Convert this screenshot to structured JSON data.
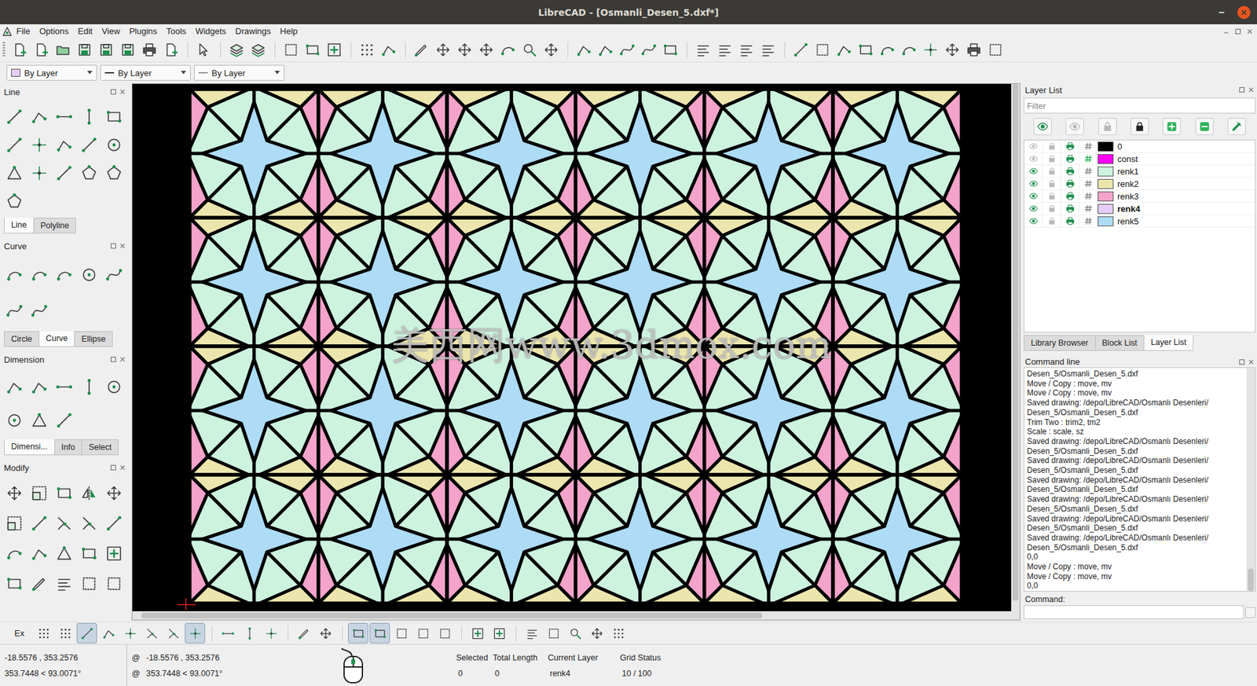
{
  "window": {
    "title": "LibreCAD - [Osmanli_Desen_5.dxf*]",
    "buttons": [
      {
        "label": "–",
        "kind": "minimize"
      },
      {
        "label": "×",
        "kind": "close"
      }
    ]
  },
  "menu": [
    "File",
    "Options",
    "Edit",
    "View",
    "Plugins",
    "Tools",
    "Widgets",
    "Drawings",
    "Help"
  ],
  "pen_toolbar": [
    {
      "label": "By Layer",
      "kind": "color"
    },
    {
      "label": "By Layer",
      "kind": "width"
    },
    {
      "label": "By Layer",
      "kind": "type"
    }
  ],
  "tool_docks": [
    {
      "title": "Line",
      "tabs": [
        {
          "label": "Line",
          "selected": true
        },
        {
          "label": "Polyline",
          "selected": false
        }
      ]
    },
    {
      "title": "Curve",
      "tabs": [
        {
          "label": "Circle",
          "selected": false
        },
        {
          "label": "Curve",
          "selected": true
        },
        {
          "label": "Ellipse",
          "selected": false
        }
      ]
    },
    {
      "title": "Dimension",
      "tabs": [
        {
          "label": "Dimensi...",
          "selected": true
        },
        {
          "label": "Info",
          "selected": false
        },
        {
          "label": "Select",
          "selected": false
        }
      ]
    },
    {
      "title": "Modify",
      "tabs": []
    }
  ],
  "canvas": {
    "watermark": "美西网www.3dmox.com",
    "h_scroll": {
      "start": 0.01,
      "level": 0.7
    },
    "v_scroll": {
      "start": 0.0,
      "level": 0.98
    }
  },
  "layer_panel": {
    "title": "Layer List",
    "filter_placeholder": "Filter",
    "layers": [
      {
        "name": "0",
        "color": "#000000",
        "visible": false,
        "locked": false,
        "print": true,
        "construction": false,
        "current": false
      },
      {
        "name": "const",
        "color": "#ff00ff",
        "visible": false,
        "locked": false,
        "print": true,
        "construction": true,
        "current": false
      },
      {
        "name": "renk1",
        "color": "#cdf3df",
        "visible": true,
        "locked": false,
        "print": true,
        "construction": false,
        "current": false
      },
      {
        "name": "renk2",
        "color": "#ece6ae",
        "visible": true,
        "locked": false,
        "print": true,
        "construction": false,
        "current": false
      },
      {
        "name": "renk3",
        "color": "#f4a3ca",
        "visible": true,
        "locked": false,
        "print": true,
        "construction": false,
        "current": false
      },
      {
        "name": "renk4",
        "color": "#e6cdf7",
        "visible": true,
        "locked": false,
        "print": true,
        "construction": false,
        "current": true
      },
      {
        "name": "renk5",
        "color": "#aedcf6",
        "visible": true,
        "locked": false,
        "print": true,
        "construction": false,
        "current": false
      }
    ]
  },
  "dock_tabs": [
    {
      "label": "Library Browser",
      "selected": false
    },
    {
      "label": "Block List",
      "selected": false
    },
    {
      "label": "Layer List",
      "selected": true
    }
  ],
  "command_line": {
    "title": "Command line",
    "prompt": "Command:",
    "scroll": {
      "start": 0.9,
      "level": 0.1
    },
    "lines": [
      "Desen_5/Osmanli_Desen_5.dxf",
      "Move / Copy : move, mv",
      "Move / Copy : move, mv",
      "Saved drawing: /depo/LibreCAD/Osmanlı Desenleri/",
      "Desen_5/Osmanli_Desen_5.dxf",
      "Trim Two : trim2, tm2",
      "Scale : scale, sz",
      "Saved drawing: /depo/LibreCAD/Osmanlı Desenleri/",
      "Desen_5/Osmanli_Desen_5.dxf",
      "Saved drawing: /depo/LibreCAD/Osmanlı Desenleri/",
      "Desen_5/Osmanli_Desen_5.dxf",
      "Saved drawing: /depo/LibreCAD/Osmanlı Desenleri/",
      "Desen_5/Osmanli_Desen_5.dxf",
      "Saved drawing: /depo/LibreCAD/Osmanlı Desenleri/",
      "Desen_5/Osmanli_Desen_5.dxf",
      "Saved drawing: /depo/LibreCAD/Osmanlı Desenleri/",
      "Desen_5/Osmanli_Desen_5.dxf",
      "Saved drawing: /depo/LibreCAD/Osmanlı Desenleri/",
      "Desen_5/Osmanli_Desen_5.dxf",
      "0,0",
      "Move / Copy : move, mv",
      "Move / Copy : move, mv",
      "0,0"
    ]
  },
  "snap_toolbar": {
    "label": "Ex",
    "toggles": [
      {
        "on": false
      },
      {
        "on": false
      },
      {
        "on": true
      },
      {
        "on": false
      },
      {
        "on": false
      },
      {
        "on": false
      },
      {
        "on": false
      },
      {
        "on": true
      },
      {
        "on": false
      },
      {
        "on": false
      },
      {
        "on": false
      },
      {
        "on": false
      },
      {
        "on": false
      },
      {
        "on": true
      },
      {
        "on": true
      },
      {
        "on": false
      },
      {
        "on": false
      },
      {
        "on": false
      },
      {
        "on": false
      },
      {
        "on": false
      },
      {
        "on": false
      },
      {
        "on": false
      },
      {
        "on": false
      },
      {
        "on": false
      },
      {
        "on": false
      }
    ]
  },
  "status_bar": {
    "absolute": [
      "-18.5576 , 353.2576",
      "353.7448 < 93.0071°"
    ],
    "relative": {
      "marker": "@",
      "values": [
        "-18.5576 , 353.2576",
        "353.7448 < 93.0071°"
      ]
    },
    "fields": [
      {
        "label": "Selected",
        "value": "0"
      },
      {
        "label": "Total Length",
        "value": "0"
      },
      {
        "label": "Current Layer",
        "value": "renk4"
      },
      {
        "label": "Grid Status",
        "value": "10 / 100"
      }
    ]
  }
}
